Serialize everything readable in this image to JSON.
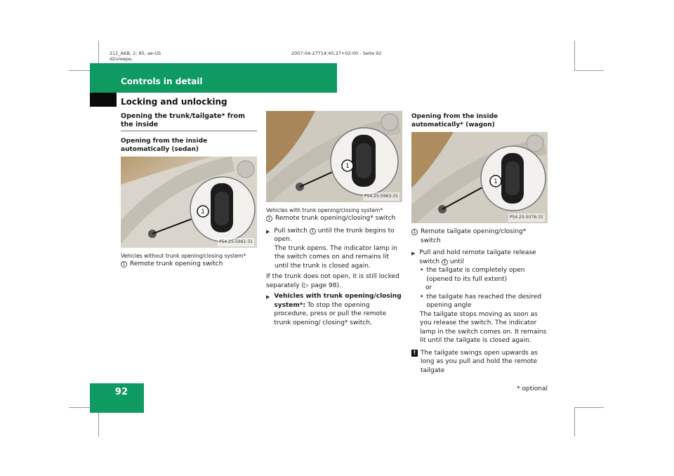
{
  "meta": {
    "line1": "211_AKB; 2; 85, ae-US",
    "line2": "d2ureepe,",
    "timestamp": "2007-04-27T14:45:37+02:00 - Seite 92"
  },
  "header": {
    "section": "Controls in detail",
    "subsection": "Locking and unlocking",
    "accent_color": "#0e9a60"
  },
  "column1": {
    "heading": "Opening the trunk/tailgate* from the inside",
    "subheading": "Opening from the inside automatically (sedan)",
    "image_code": "P54.25-5961-31",
    "caption": "Vehicles without trunk opening/closing system*",
    "legend_num": "1",
    "legend_text": "Remote trunk opening switch"
  },
  "column2": {
    "image_code": "P54.25-5963-31",
    "caption": "Vehicles with trunk opening/closing system*",
    "legend_num": "1",
    "legend_text": "Remote trunk opening/closing* switch",
    "step1_pre": "Pull switch",
    "step1_num": "1",
    "step1_post": "until the trunk begins to open.",
    "step1_detail": "The trunk opens. The indicator lamp in the switch comes on and remains lit until the trunk is closed again.",
    "note": "If the trunk does not open, it is still locked separately (▷ page 98).",
    "step2_bold": "Vehicles with trunk opening/closing system*:",
    "step2_text": "To stop the opening procedure, press or pull the remote trunk opening/ closing* switch."
  },
  "column3": {
    "heading": "Opening from the inside automatically* (wagon)",
    "image_code": "P54.25-5076-31",
    "legend_num": "1",
    "legend_text": "Remote tailgate opening/closing* switch",
    "step1_pre": "Pull and hold remote tailgate release switch",
    "step1_num": "1",
    "step1_post": "until",
    "bullet1": "the tailgate is completely open (opened to its full extent)",
    "or_text": "or",
    "bullet2": "the tailgate has reached the desired opening angle",
    "detail": "The tailgate stops moving as soon as you release the switch. The indicator lamp in the switch comes on. It remains lit until the tailgate is closed again.",
    "warning": "The tailgate swings open upwards as long as you pull and hold the remote tailgate"
  },
  "footer": {
    "page_number": "92",
    "optional_note": "* optional"
  }
}
